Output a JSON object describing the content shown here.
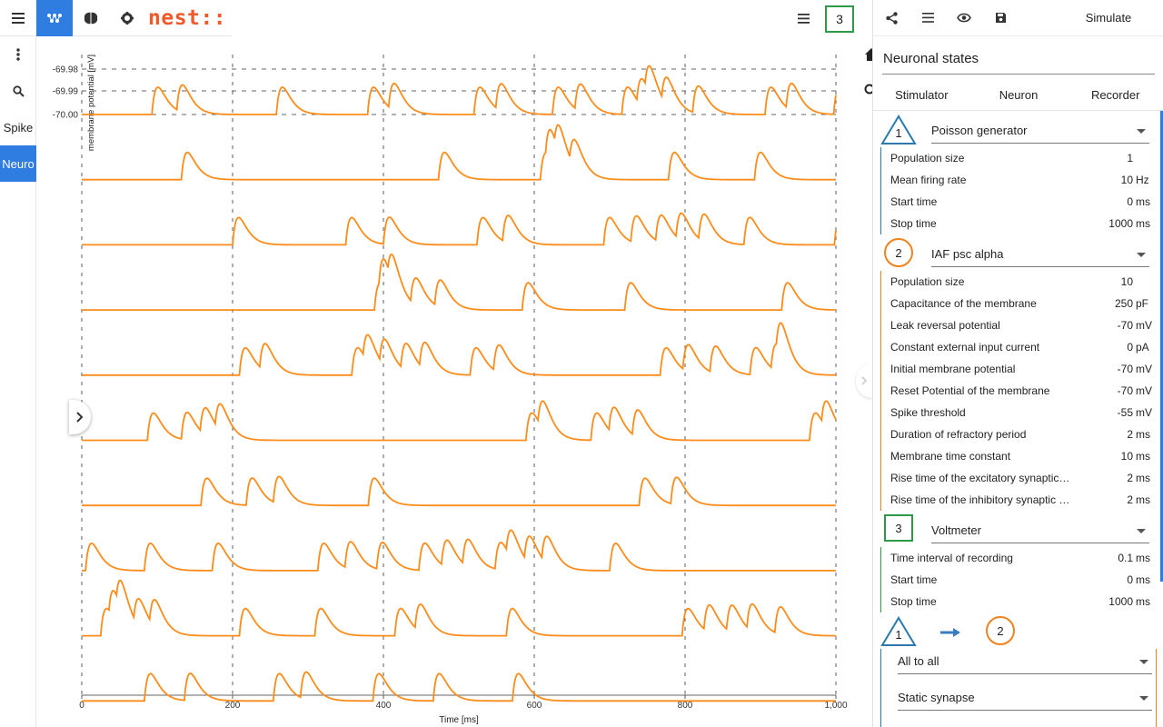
{
  "app": {
    "brand": "nest::"
  },
  "toolbar": {
    "menu_icon": "menu-icon",
    "network_icon": "network-icon",
    "brain_icon": "brain-icon",
    "settings_icon": "gear-icon"
  },
  "rail": {
    "items": [
      "Spike",
      "Neuro"
    ]
  },
  "plot": {
    "node_badge": "3"
  },
  "panel": {
    "simulate_label": "Simulate",
    "title": "Neuronal states",
    "tabs": [
      "Stimulator",
      "Neuron",
      "Recorder"
    ]
  },
  "nodes": [
    {
      "index": "1",
      "model": "Poisson generator",
      "color": "#2a7ab0",
      "params": [
        {
          "label": "Population size",
          "value": "1",
          "unit": ""
        },
        {
          "label": "Mean firing rate",
          "value": "10",
          "unit": "Hz"
        },
        {
          "label": "Start time",
          "value": "0",
          "unit": "ms"
        },
        {
          "label": "Stop time",
          "value": "1000",
          "unit": "ms"
        }
      ]
    },
    {
      "index": "2",
      "model": "IAF psc alpha",
      "color": "#f0821e",
      "params": [
        {
          "label": "Population size",
          "value": "10",
          "unit": ""
        },
        {
          "label": "Capacitance of the membrane",
          "value": "250",
          "unit": "pF"
        },
        {
          "label": "Leak reversal potential",
          "value": "-70",
          "unit": "mV"
        },
        {
          "label": "Constant external input current",
          "value": "0",
          "unit": "pA"
        },
        {
          "label": "Initial membrane potential",
          "value": "-70",
          "unit": "mV"
        },
        {
          "label": "Reset Potential of the membrane",
          "value": "-70",
          "unit": "mV"
        },
        {
          "label": "Spike threshold",
          "value": "-55",
          "unit": "mV"
        },
        {
          "label": "Duration of refractory period",
          "value": "2",
          "unit": "ms"
        },
        {
          "label": "Membrane time constant",
          "value": "10",
          "unit": "ms"
        },
        {
          "label": "Rise time of the excitatory synaptic alpha function",
          "value": "2",
          "unit": "ms"
        },
        {
          "label": "Rise time of the inhibitory synaptic alpha function",
          "value": "2",
          "unit": "ms"
        }
      ]
    },
    {
      "index": "3",
      "model": "Voltmeter",
      "color": "#2e9a47",
      "params": [
        {
          "label": "Time interval of recording",
          "value": "0.1",
          "unit": "ms"
        },
        {
          "label": "Start time",
          "value": "0",
          "unit": "ms"
        },
        {
          "label": "Stop time",
          "value": "1000",
          "unit": "ms"
        }
      ]
    }
  ],
  "connection": {
    "source": "1",
    "target": "2",
    "rule": "All to all",
    "synapse": "Static synapse"
  },
  "chart_data": {
    "type": "line",
    "xlabel": "Time [ms]",
    "ylabel": "membrane potential [mV]",
    "xlim": [
      0,
      1000
    ],
    "x_ticks": [
      "0",
      "200",
      "400",
      "600",
      "800",
      "1,000"
    ],
    "y_ticks": [
      "-69.98",
      "-69.99",
      "-70.00"
    ],
    "line_color": "#ff8c1a",
    "baseline_mv": -70.0,
    "traces": [
      {
        "spikes": [
          93,
          126,
          258,
          379,
          407,
          520,
          549,
          624,
          654,
          716,
          736,
          747,
          769,
          810,
          906,
          934,
          997
        ]
      },
      {
        "spikes": [
          132,
          473,
          608,
          615,
          627,
          647,
          778,
          892
        ]
      },
      {
        "spikes": [
          200,
          350,
          400,
          524,
          558,
          692,
          728,
          761,
          788,
          818,
          878,
          998
        ]
      },
      {
        "spikes": [
          388,
          394,
          406,
          436,
          468,
          584,
          720,
          928
        ]
      },
      {
        "spikes": [
          209,
          236,
          358,
          373,
          395,
          423,
          448,
          515,
          546,
          767,
          797,
          833,
          886,
          914,
          921
        ]
      },
      {
        "spikes": [
          87,
          132,
          157,
          177,
          589,
          605,
          675,
          699,
          730,
          965,
          981,
          1000
        ]
      },
      {
        "spikes": [
          158,
          218,
          254,
          380,
          739,
          781
        ]
      },
      {
        "spikes": [
          5,
          83,
          173,
          313,
          349,
          391,
          447,
          477,
          505,
          548,
          563,
          587,
          610,
          700
        ]
      },
      {
        "spikes": [
          25,
          36,
          46,
          69,
          90,
          209,
          309,
          415,
          442,
          563,
          796,
          825,
          855,
          882,
          919,
          1000
        ]
      },
      {
        "spikes": [
          83,
          136,
          254,
          290,
          386,
          466,
          571
        ]
      }
    ]
  }
}
